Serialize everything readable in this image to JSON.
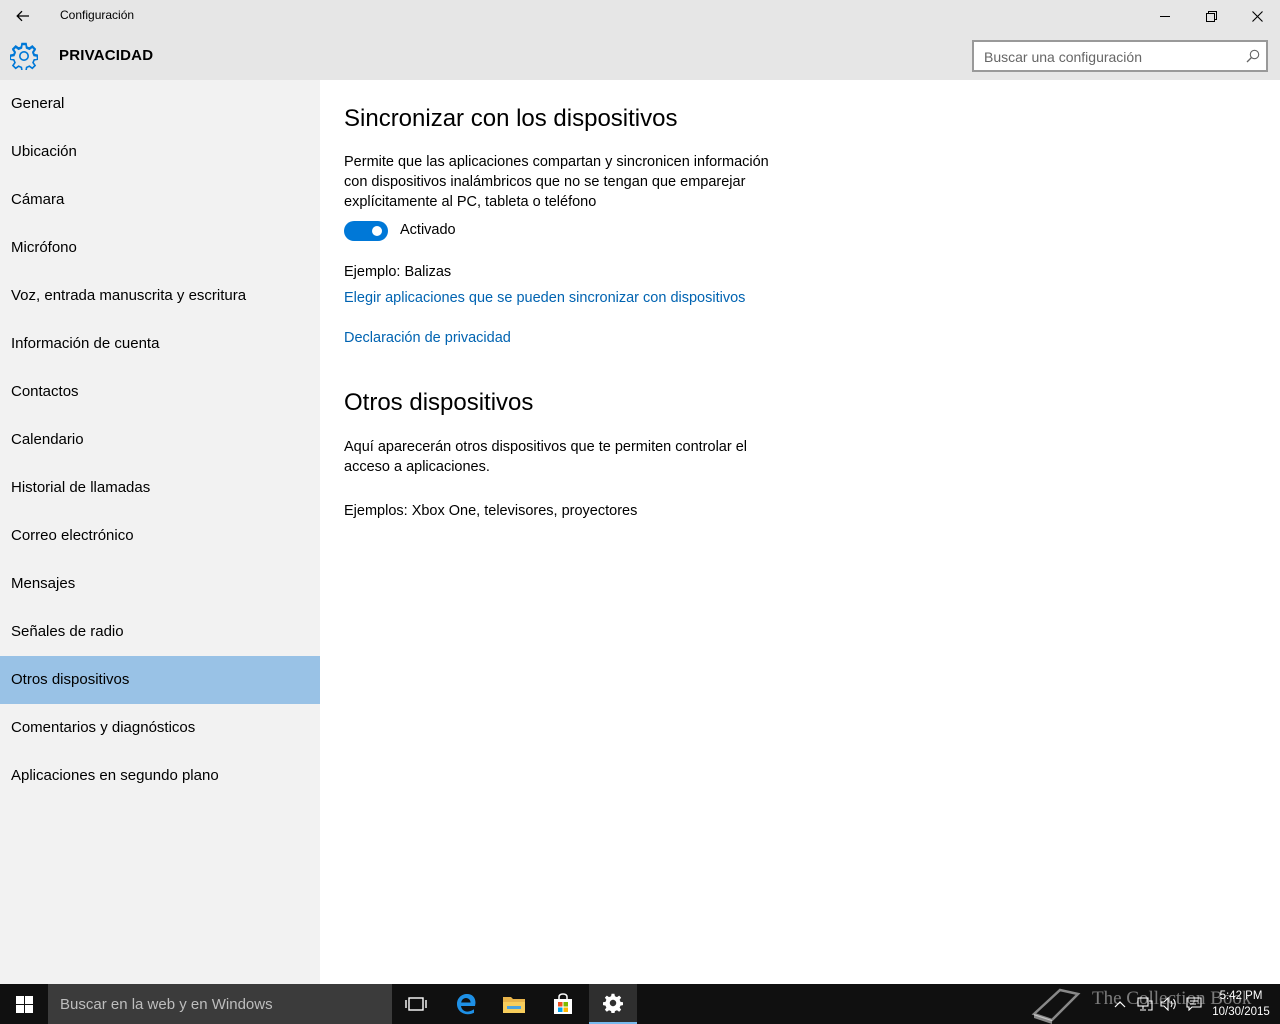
{
  "window": {
    "title": "Configuración",
    "controls": [
      "minimize-icon",
      "restore-icon",
      "close-icon"
    ]
  },
  "header": {
    "section_title": "PRIVACIDAD",
    "icon": "gear-icon",
    "search_placeholder": "Buscar una configuración"
  },
  "sidebar": {
    "items": [
      {
        "label": "General",
        "selected": false
      },
      {
        "label": "Ubicación",
        "selected": false
      },
      {
        "label": "Cámara",
        "selected": false
      },
      {
        "label": "Micrófono",
        "selected": false
      },
      {
        "label": "Voz, entrada manuscrita y escritura",
        "selected": false
      },
      {
        "label": "Información de cuenta",
        "selected": false
      },
      {
        "label": "Contactos",
        "selected": false
      },
      {
        "label": "Calendario",
        "selected": false
      },
      {
        "label": "Historial de llamadas",
        "selected": false
      },
      {
        "label": "Correo electrónico",
        "selected": false
      },
      {
        "label": "Mensajes",
        "selected": false
      },
      {
        "label": "Señales de radio",
        "selected": false
      },
      {
        "label": "Otros dispositivos",
        "selected": true
      },
      {
        "label": "Comentarios y diagnósticos",
        "selected": false
      },
      {
        "label": "Aplicaciones en segundo plano",
        "selected": false
      }
    ]
  },
  "main": {
    "sync": {
      "heading": "Sincronizar con los dispositivos",
      "description": "Permite que las aplicaciones compartan y sincronicen información con dispositivos inalámbricos que no se tengan que emparejar explícitamente al PC, tableta o teléfono",
      "toggle_state": "Activado",
      "toggle_on": true,
      "example": "Ejemplo: Balizas",
      "choose_apps_link": "Elegir aplicaciones que se pueden sincronizar con dispositivos",
      "privacy_link": "Declaración de privacidad"
    },
    "other": {
      "heading": "Otros dispositivos",
      "description": "Aquí aparecerán otros dispositivos que te permiten controlar el acceso a aplicaciones.",
      "examples": "Ejemplos: Xbox One, televisores, proyectores"
    }
  },
  "taskbar": {
    "search_placeholder": "Buscar en la web y en Windows",
    "apps": [
      "task-view-icon",
      "edge-icon",
      "file-explorer-icon",
      "store-icon",
      "settings-icon"
    ],
    "active_app": "settings-icon",
    "time": "5:42 PM",
    "date": "10/30/2015",
    "watermark": "The Collection Book"
  },
  "colors": {
    "accent": "#0078d7",
    "link": "#0063b1",
    "selected_nav": "#99c2e6",
    "sidebar_bg": "#f2f2f2",
    "header_bg": "#e6e6e6",
    "taskbar_bg": "#101010"
  }
}
